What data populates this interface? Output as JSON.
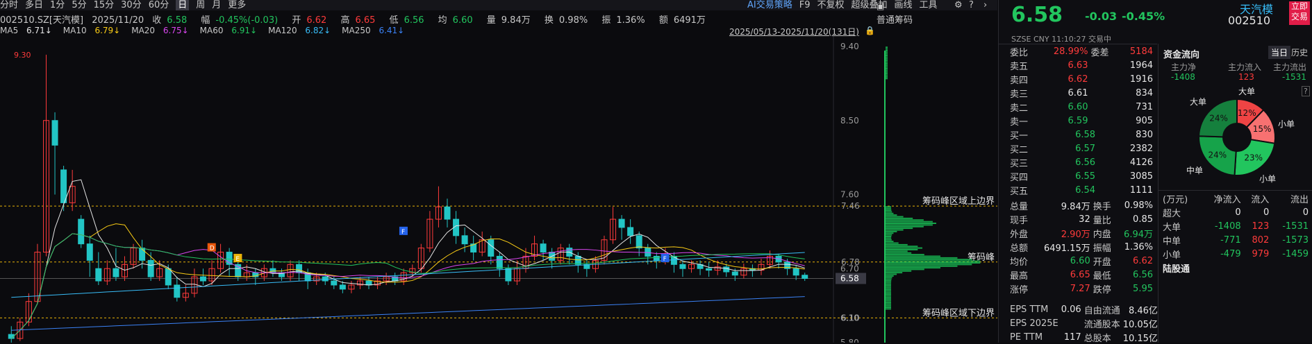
{
  "toolbar": {
    "periods": [
      "分时",
      "多日",
      "1分",
      "5分",
      "15分",
      "30分",
      "60分",
      "日",
      "周",
      "月",
      "更多"
    ],
    "selected_period": "日",
    "right_items": [
      "AI交易策略",
      "F9",
      "不复权",
      "超级叠加",
      "画线",
      "工具"
    ],
    "chip_panel_title": "普通筹码"
  },
  "info": {
    "code": "002510.SZ[天汽模]",
    "date": "2025/11/20",
    "close_label": "收",
    "close": "6.58",
    "change_label": "幅",
    "change": "-0.45%(-0.03)",
    "open_label": "开",
    "open": "6.62",
    "high_label": "高",
    "high": "6.65",
    "low_label": "低",
    "low": "6.56",
    "avg_label": "均",
    "avg": "6.60",
    "vol_label": "量",
    "vol": "9.84万",
    "turnover_label": "换",
    "turnover": "0.98%",
    "amp_label": "振",
    "amp": "1.36%",
    "amount_label": "额",
    "amount": "6491万"
  },
  "ma": [
    {
      "name": "MA5",
      "value": "6.71↓",
      "color": "#e6e6e6"
    },
    {
      "name": "MA10",
      "value": "6.79↓",
      "color": "#facc15"
    },
    {
      "name": "MA20",
      "value": "6.75↓",
      "color": "#d946ef"
    },
    {
      "name": "MA60",
      "value": "6.91↓",
      "color": "#22c55e"
    },
    {
      "name": "MA120",
      "value": "6.82↓",
      "color": "#38bdf8"
    },
    {
      "name": "MA250",
      "value": "6.41↓",
      "color": "#3b82f6"
    }
  ],
  "range_label": "2025/05/13-2025/11/20(131日)",
  "chart_data": {
    "type": "candlestick",
    "price_ticks": [
      "9.40",
      "8.50",
      "7.60",
      "6.70",
      "6.10",
      "5.80"
    ],
    "max_label": "9.30",
    "current_price": "6.58",
    "chip_levels": [
      {
        "label": "7.46",
        "name": "筹码峰区域上边界"
      },
      {
        "label": "6.78",
        "name": "筹码峰"
      },
      {
        "label": "6.10",
        "name": "筹码峰区域下边界"
      }
    ],
    "markers": [
      "D",
      "E",
      "F",
      "F"
    ],
    "candles": [
      [
        5.9,
        5.85,
        6.0,
        5.8
      ],
      [
        5.85,
        6.05,
        6.1,
        5.82
      ],
      [
        6.05,
        6.3,
        6.4,
        6.0
      ],
      [
        6.3,
        6.9,
        7.0,
        6.28
      ],
      [
        6.9,
        8.5,
        9.3,
        6.85
      ],
      [
        8.5,
        8.2,
        8.6,
        7.6
      ],
      [
        7.9,
        7.5,
        7.95,
        7.4
      ],
      [
        7.5,
        7.7,
        7.9,
        7.4
      ],
      [
        7.3,
        7.0,
        7.35,
        6.95
      ],
      [
        7.0,
        6.8,
        7.1,
        6.6
      ],
      [
        6.7,
        6.55,
        6.9,
        6.5
      ],
      [
        6.55,
        6.7,
        6.8,
        6.5
      ],
      [
        6.7,
        6.6,
        6.95,
        6.55
      ],
      [
        6.6,
        6.75,
        6.85,
        6.55
      ],
      [
        6.75,
        6.95,
        7.0,
        6.7
      ],
      [
        6.95,
        6.8,
        7.05,
        6.7
      ],
      [
        6.8,
        6.6,
        6.9,
        6.55
      ],
      [
        6.6,
        6.7,
        6.8,
        6.55
      ],
      [
        6.7,
        6.5,
        6.75,
        6.45
      ],
      [
        6.5,
        6.35,
        6.6,
        6.3
      ],
      [
        6.35,
        6.4,
        6.5,
        6.3
      ],
      [
        6.4,
        6.6,
        6.7,
        6.35
      ],
      [
        6.6,
        6.55,
        6.7,
        6.5
      ],
      [
        6.55,
        6.7,
        6.8,
        6.5
      ],
      [
        6.7,
        6.9,
        7.0,
        6.65
      ],
      [
        6.9,
        6.75,
        6.95,
        6.6
      ],
      [
        6.75,
        6.6,
        6.8,
        6.55
      ],
      [
        6.6,
        6.65,
        6.75,
        6.55
      ],
      [
        6.65,
        6.6,
        6.7,
        6.5
      ],
      [
        6.6,
        6.7,
        6.75,
        6.55
      ],
      [
        6.7,
        6.65,
        6.8,
        6.6
      ],
      [
        6.65,
        6.6,
        6.7,
        6.55
      ],
      [
        6.6,
        6.75,
        6.8,
        6.55
      ],
      [
        6.75,
        6.65,
        6.8,
        6.55
      ],
      [
        6.65,
        6.55,
        6.7,
        6.45
      ],
      [
        6.55,
        6.6,
        6.65,
        6.5
      ],
      [
        6.6,
        6.55,
        6.65,
        6.5
      ],
      [
        6.55,
        6.5,
        6.6,
        6.45
      ],
      [
        6.5,
        6.45,
        6.55,
        6.4
      ],
      [
        6.45,
        6.5,
        6.55,
        6.4
      ],
      [
        6.5,
        6.55,
        6.6,
        6.45
      ],
      [
        6.55,
        6.5,
        6.6,
        6.45
      ],
      [
        6.5,
        6.55,
        6.6,
        6.45
      ],
      [
        6.55,
        6.6,
        6.65,
        6.5
      ],
      [
        6.6,
        6.55,
        6.65,
        6.5
      ],
      [
        6.55,
        6.65,
        6.7,
        6.5
      ],
      [
        6.65,
        6.7,
        6.75,
        6.6
      ],
      [
        6.7,
        6.95,
        7.0,
        6.65
      ],
      [
        6.95,
        7.3,
        7.4,
        6.9
      ],
      [
        7.3,
        7.45,
        7.7,
        7.2
      ],
      [
        7.45,
        7.3,
        7.55,
        7.2
      ],
      [
        7.3,
        7.1,
        7.4,
        7.0
      ],
      [
        7.1,
        7.0,
        7.2,
        6.9
      ],
      [
        7.0,
        6.9,
        7.1,
        6.8
      ],
      [
        6.9,
        7.05,
        7.15,
        6.85
      ],
      [
        7.05,
        6.85,
        7.1,
        6.75
      ],
      [
        6.85,
        6.7,
        6.9,
        6.6
      ],
      [
        6.7,
        6.55,
        6.75,
        6.5
      ],
      [
        6.55,
        6.7,
        6.8,
        6.5
      ],
      [
        6.7,
        6.85,
        6.95,
        6.65
      ],
      [
        6.85,
        7.0,
        7.1,
        6.8
      ],
      [
        7.0,
        6.9,
        7.05,
        6.8
      ],
      [
        6.9,
        6.8,
        6.95,
        6.7
      ],
      [
        6.8,
        6.95,
        7.0,
        6.75
      ],
      [
        6.95,
        6.85,
        7.0,
        6.75
      ],
      [
        6.85,
        6.75,
        6.9,
        6.65
      ],
      [
        6.75,
        6.7,
        6.8,
        6.6
      ],
      [
        6.7,
        6.8,
        6.85,
        6.65
      ],
      [
        6.8,
        7.05,
        7.1,
        6.75
      ],
      [
        7.05,
        7.3,
        7.45,
        7.0
      ],
      [
        7.3,
        7.2,
        7.35,
        7.05
      ],
      [
        7.2,
        7.1,
        7.3,
        7.0
      ],
      [
        7.1,
        6.95,
        7.15,
        6.85
      ],
      [
        6.95,
        6.85,
        7.0,
        6.75
      ],
      [
        6.85,
        6.8,
        6.9,
        6.7
      ],
      [
        6.8,
        6.85,
        6.95,
        6.75
      ],
      [
        6.85,
        6.75,
        6.9,
        6.65
      ],
      [
        6.75,
        6.7,
        6.8,
        6.6
      ],
      [
        6.7,
        6.75,
        6.8,
        6.65
      ],
      [
        6.75,
        6.7,
        6.8,
        6.62
      ],
      [
        6.7,
        6.68,
        6.78,
        6.6
      ],
      [
        6.68,
        6.72,
        6.8,
        6.62
      ],
      [
        6.72,
        6.66,
        6.76,
        6.6
      ],
      [
        6.66,
        6.62,
        6.7,
        6.55
      ],
      [
        6.62,
        6.7,
        6.76,
        6.58
      ],
      [
        6.7,
        6.68,
        6.75,
        6.6
      ],
      [
        6.68,
        6.75,
        6.82,
        6.62
      ],
      [
        6.75,
        6.85,
        6.92,
        6.7
      ],
      [
        6.85,
        6.78,
        6.88,
        6.7
      ],
      [
        6.78,
        6.7,
        6.82,
        6.62
      ],
      [
        6.7,
        6.62,
        6.74,
        6.56
      ],
      [
        6.62,
        6.58,
        6.65,
        6.55
      ]
    ]
  },
  "quote": {
    "price": "6.58",
    "change": "-0.03",
    "change_pct": "-0.45%",
    "name": "天汽模",
    "code": "002510",
    "trade_btn": "立即交易",
    "market": "SZSE",
    "currency": "CNY",
    "time": "11:10:27",
    "status": "交易中",
    "weibi_label": "委比",
    "weibi": "28.99%",
    "weicha_label": "委差",
    "weicha": "5184"
  },
  "asks": [
    {
      "label": "卖五",
      "price": "6.63",
      "vol": "1964",
      "color": "red"
    },
    {
      "label": "卖四",
      "price": "6.62",
      "vol": "1916",
      "color": "red"
    },
    {
      "label": "卖三",
      "price": "6.61",
      "vol": "834",
      "color": "white"
    },
    {
      "label": "卖二",
      "price": "6.60",
      "vol": "731",
      "color": "green"
    },
    {
      "label": "卖一",
      "price": "6.59",
      "vol": "905",
      "color": "green"
    }
  ],
  "bids": [
    {
      "label": "买一",
      "price": "6.58",
      "vol": "830",
      "color": "green"
    },
    {
      "label": "买二",
      "price": "6.57",
      "vol": "2382",
      "color": "green"
    },
    {
      "label": "买三",
      "price": "6.56",
      "vol": "4126",
      "color": "green"
    },
    {
      "label": "买四",
      "price": "6.55",
      "vol": "3085",
      "color": "green"
    },
    {
      "label": "买五",
      "price": "6.54",
      "vol": "1111",
      "color": "green"
    }
  ],
  "stats": [
    {
      "l1": "总量",
      "v1": "9.84万",
      "c1": "white",
      "l2": "换手",
      "v2": "0.98%",
      "c2": "white"
    },
    {
      "l1": "现手",
      "v1": "32",
      "c1": "white",
      "l2": "量比",
      "v2": "0.85",
      "c2": "white"
    },
    {
      "l1": "外盘",
      "v1": "2.90万",
      "c1": "red",
      "l2": "内盘",
      "v2": "6.94万",
      "c2": "green"
    },
    {
      "l1": "总额",
      "v1": "6491.15万",
      "c1": "white",
      "l2": "振幅",
      "v2": "1.36%",
      "c2": "white"
    },
    {
      "l1": "均价",
      "v1": "6.60",
      "c1": "green",
      "l2": "开盘",
      "v2": "6.62",
      "c2": "red"
    },
    {
      "l1": "最高",
      "v1": "6.65",
      "c1": "red",
      "l2": "最低",
      "v2": "6.56",
      "c2": "green"
    },
    {
      "l1": "涨停",
      "v1": "7.27",
      "c1": "red",
      "l2": "跌停",
      "v2": "5.95",
      "c2": "green"
    }
  ],
  "fundamentals": [
    {
      "l1": "EPS TTM",
      "v1": "0.06",
      "l2": "自由流通",
      "v2": "8.46亿"
    },
    {
      "l1": "EPS 2025E",
      "v1": "",
      "l2": "流通股本",
      "v2": "10.05亿"
    },
    {
      "l1": "PE TTM",
      "v1": "117",
      "l2": "总股本",
      "v2": "10.15亿"
    }
  ],
  "flow": {
    "title": "资金流向",
    "tab_today": "当日",
    "tab_hist": "历史",
    "main_net_label": "主力净",
    "main_in_label": "主力流入",
    "main_out_label": "主力流出",
    "main_net": "-1408",
    "main_in": "123",
    "main_out": "-1531",
    "help": "?",
    "pie_labels": {
      "big": "大单",
      "small": "小单",
      "mid": "中单",
      "super": "大单"
    },
    "pie": [
      {
        "label": "12%",
        "value": 12,
        "color": "#ef4444"
      },
      {
        "label": "15%",
        "value": 15,
        "color": "#f87171"
      },
      {
        "label": "23%",
        "value": 23,
        "color": "#22c55e"
      },
      {
        "label": "24%",
        "value": 24,
        "color": "#16a34a"
      },
      {
        "label": "24%",
        "value": 24,
        "color": "#15803d"
      }
    ],
    "unit": "(万元)",
    "cols": [
      "净流入",
      "流入",
      "流出"
    ],
    "rows": [
      {
        "name": "超大",
        "net": "0",
        "in": "0",
        "out": "0",
        "c": "white"
      },
      {
        "name": "大单",
        "net": "-1408",
        "in": "123",
        "out": "-1531",
        "c": "mix"
      },
      {
        "name": "中单",
        "net": "-771",
        "in": "802",
        "out": "-1573",
        "c": "mix"
      },
      {
        "name": "小单",
        "net": "-479",
        "in": "979",
        "out": "-1459",
        "c": "mix"
      }
    ],
    "lugutong": "陆股通"
  }
}
